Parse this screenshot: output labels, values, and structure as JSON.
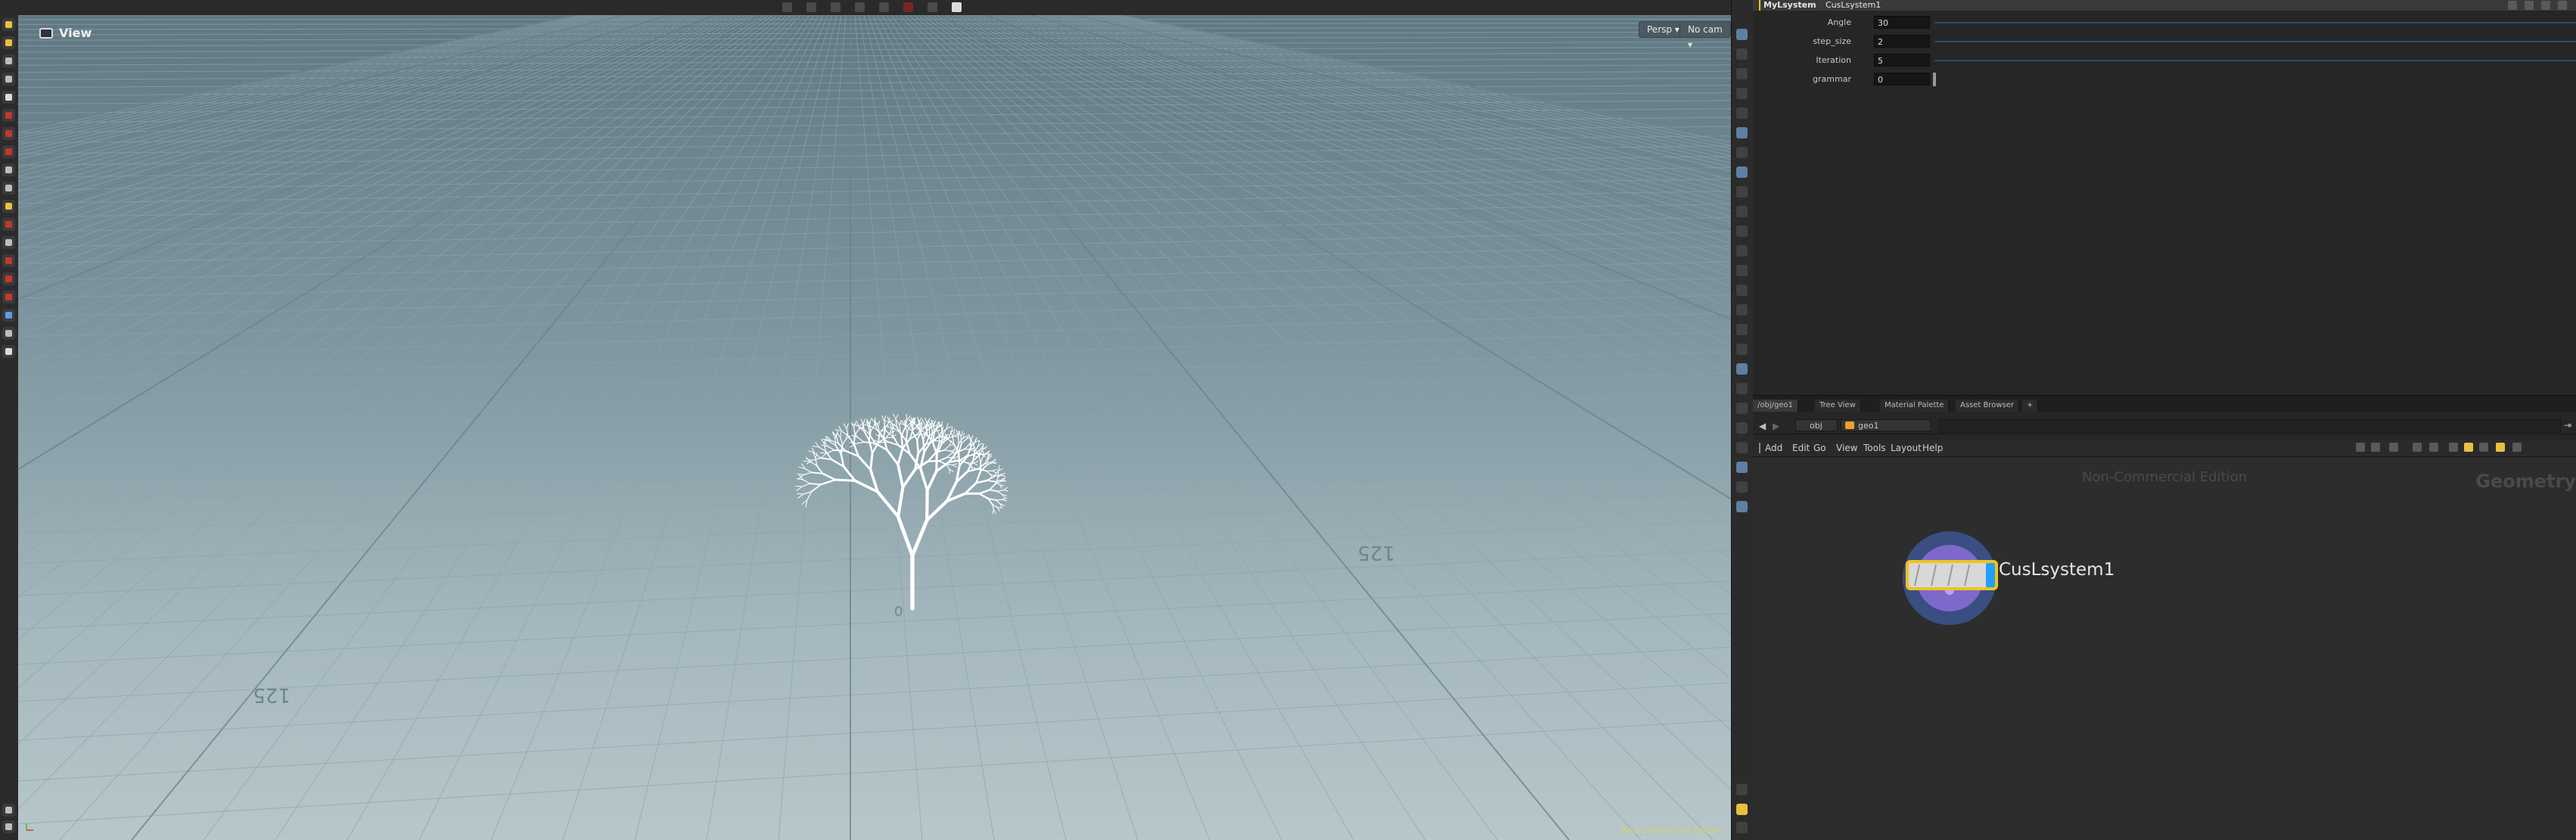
{
  "viewport": {
    "title": "View",
    "persp_button": "Persp ▾",
    "cam_button": "No cam ▾",
    "grid_labels": [
      "125",
      "125",
      "0"
    ],
    "watermark": "Non-Commercial Edition"
  },
  "parameters": {
    "node_type": "MyLsystem",
    "node_name": "CusLsystem1",
    "rows": [
      {
        "label": "Angle",
        "value": "30",
        "fill": 1.0
      },
      {
        "label": "step_size",
        "value": "2",
        "fill": 1.0
      },
      {
        "label": "Iteration",
        "value": "5",
        "fill": 1.0
      },
      {
        "label": "grammar",
        "value": "0",
        "fill": 0.0
      }
    ]
  },
  "network_pane": {
    "tabs": [
      "/obj/geo1",
      "Tree View",
      "Material Palette",
      "Asset Browser",
      "+"
    ],
    "path_segments": [
      "obj",
      "geo1"
    ],
    "menu": [
      "Add",
      "Edit",
      "Go",
      "View",
      "Tools",
      "Layout",
      "Help"
    ],
    "watermark": "Non-Commercial Edition",
    "context_label": "Geometry",
    "node": {
      "name": "CusLsystem1"
    }
  },
  "colors": {
    "accent": "#f0c419",
    "node_flag": "#22a0ff",
    "node_ring": "#7c6fd0"
  }
}
